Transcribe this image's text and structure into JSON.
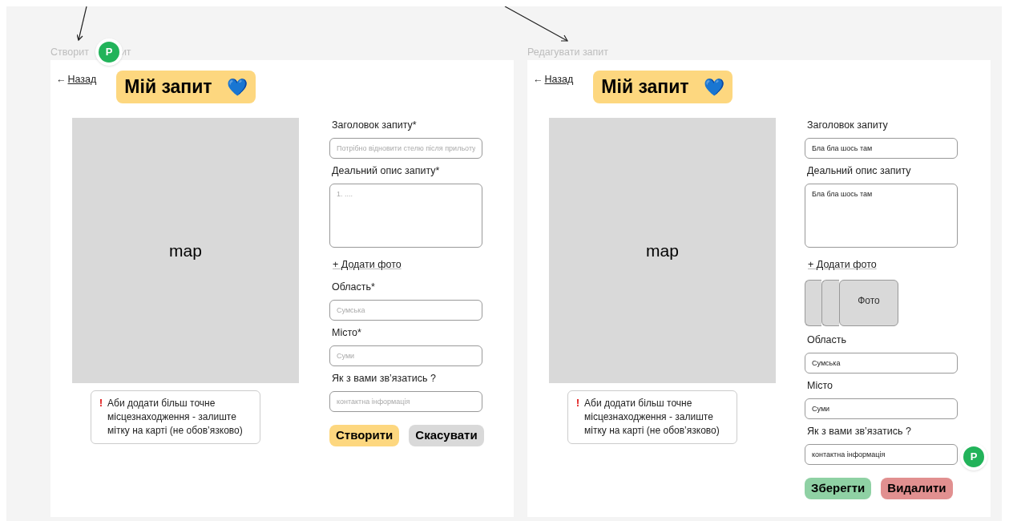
{
  "frames": [
    {
      "label": "Створит",
      "label_tail": "ит",
      "avatar": "P",
      "back_arrow": "←",
      "back_link": "Назад",
      "title": "Мій запит",
      "title_emoji": "💙",
      "map_label": "map",
      "note": {
        "mark": "!",
        "text": "Аби додати більш точне місцезнаходження - залиште мітку на карті (не обовʼязково)"
      },
      "form": [
        {
          "kind": "input",
          "label": "Заголовок запиту*",
          "placeholder": "Потрібно відновити стелю після прильоту"
        },
        {
          "kind": "textarea",
          "label": "Деальний опис запиту*",
          "placeholder": "1. ...."
        },
        {
          "kind": "link",
          "text": "+ Додати фото"
        },
        {
          "kind": "input",
          "label": "Область*",
          "placeholder": "Сумська"
        },
        {
          "kind": "input",
          "label": "Місто*",
          "placeholder": "Суми"
        },
        {
          "kind": "input",
          "label": "Як з вами звʼязатись ?",
          "placeholder": "контактна інформація"
        }
      ],
      "buttons": [
        {
          "text": "Створити",
          "color": "#fdd77f"
        },
        {
          "text": "Скасувати",
          "color": "#d9d9d9"
        }
      ]
    },
    {
      "label": "Редагувати запит",
      "avatar": "P",
      "back_arrow": "←",
      "back_link": "Назад",
      "title": "Мій запит",
      "title_emoji": "💙",
      "map_label": "map",
      "note": {
        "mark": "!",
        "text": "Аби додати більш точне місцезнаходження - залиште мітку на карті (не обовʼязково)"
      },
      "form": [
        {
          "kind": "input",
          "label": "Заголовок запиту",
          "value": "Бла бла шось там"
        },
        {
          "kind": "textarea",
          "label": "Деальний опис запиту",
          "value": "Бла бла шось там"
        },
        {
          "kind": "link",
          "text": "+ Додати фото"
        },
        {
          "kind": "photos",
          "caption": "Фото"
        },
        {
          "kind": "input",
          "label": "Область",
          "value": "Сумська"
        },
        {
          "kind": "input",
          "label": "Місто",
          "value": "Суми"
        },
        {
          "kind": "input",
          "label": "Як з вами звʼязатись ?",
          "value": "контактна інформація"
        }
      ],
      "buttons": [
        {
          "text": "Зберегти",
          "color": "#8fd1a4"
        },
        {
          "text": "Видалити",
          "color": "#e19090"
        }
      ]
    }
  ]
}
